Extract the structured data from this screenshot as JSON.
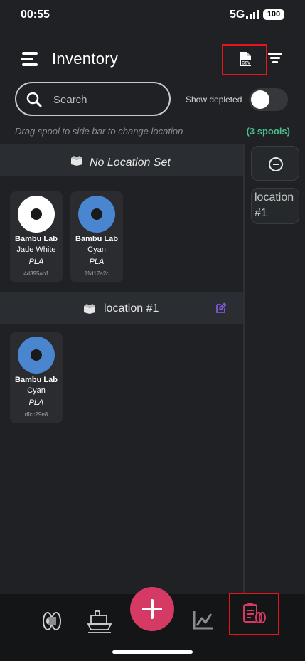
{
  "status_bar": {
    "time": "00:55",
    "network": "5G",
    "battery": "100"
  },
  "header": {
    "title": "Inventory",
    "csv_label": "CSV"
  },
  "search": {
    "placeholder": "Search"
  },
  "filters": {
    "show_depleted_label": "Show depleted",
    "show_depleted_on": false
  },
  "hint": {
    "text": "Drag spool to side bar to change location",
    "spool_count": "(3 spools)"
  },
  "sections": [
    {
      "title": "No Location Set",
      "spools": [
        {
          "brand": "Bambu Lab",
          "color_name": "Jade White",
          "material": "PLA",
          "id": "4d395ab1",
          "color": "#ffffff"
        },
        {
          "brand": "Bambu Lab",
          "color_name": "Cyan",
          "material": "PLA",
          "id": "11d17a2c",
          "color": "#4a86d0"
        }
      ]
    },
    {
      "title": "location #1",
      "spools": [
        {
          "brand": "Bambu Lab",
          "color_name": "Cyan",
          "material": "PLA",
          "id": "dfcc29e8",
          "color": "#4a86d0"
        }
      ]
    }
  ],
  "side_bar": {
    "location_label": "location #1"
  },
  "colors": {
    "accent": "#d43a63",
    "count_green": "#4dbf8c",
    "edit_purple": "#8b5cf6",
    "highlight_red": "#e8141b"
  }
}
